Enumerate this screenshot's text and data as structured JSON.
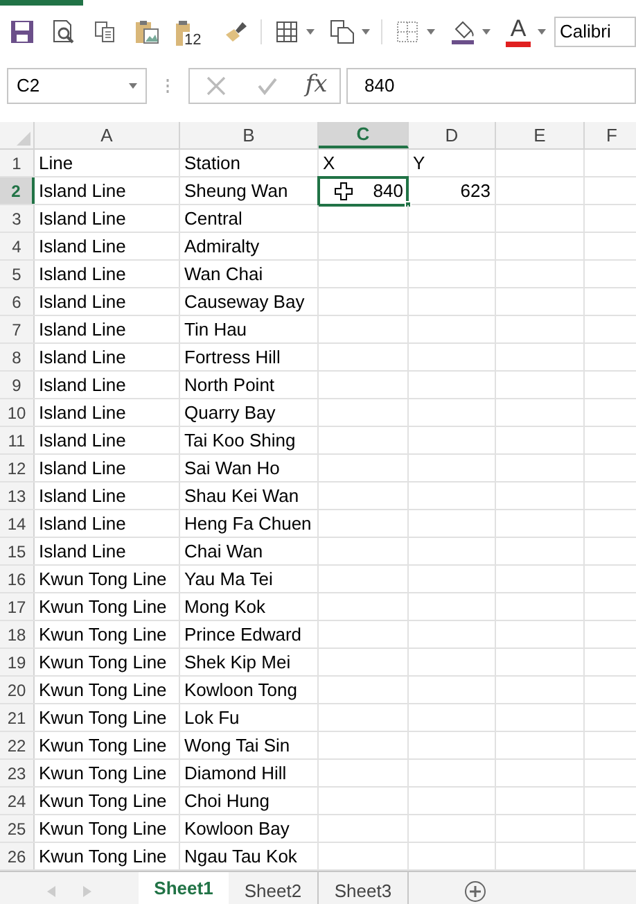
{
  "toolbar": [
    {
      "kind": "save",
      "dropdown": false
    },
    {
      "kind": "preview",
      "dropdown": false
    },
    {
      "kind": "copy",
      "dropdown": false
    },
    {
      "kind": "paste-picture",
      "dropdown": false
    },
    {
      "kind": "paste-values",
      "dropdown": false,
      "badge": "12"
    },
    {
      "kind": "painter",
      "dropdown": false
    },
    {
      "kind": "separator"
    },
    {
      "kind": "borders",
      "dropdown": true
    },
    {
      "kind": "paste-special",
      "dropdown": true
    },
    {
      "kind": "separator"
    },
    {
      "kind": "gridlines",
      "dropdown": true
    },
    {
      "kind": "fill-color",
      "dropdown": true
    },
    {
      "kind": "font-color",
      "dropdown": true,
      "text": "A"
    }
  ],
  "font_field": {
    "value": "Calibri"
  },
  "formula_bar": {
    "name_box": "C2",
    "fx": "fx",
    "value": "840",
    "cancel_disabled": true,
    "enter_disabled": true
  },
  "columns": [
    {
      "label": "A",
      "selected": false
    },
    {
      "label": "B",
      "selected": false
    },
    {
      "label": "C",
      "selected": true
    },
    {
      "label": "D",
      "selected": false
    },
    {
      "label": "E",
      "selected": false
    },
    {
      "label": "F",
      "selected": false
    }
  ],
  "rows": [
    {
      "number": "1",
      "selected": false,
      "cells": [
        "Line",
        "Station",
        "X",
        "Y"
      ]
    },
    {
      "number": "2",
      "selected": true,
      "cells": [
        "Island Line",
        "Sheung Wan"
      ],
      "numbers": [
        "840",
        "623"
      ]
    },
    {
      "number": "3",
      "selected": false,
      "cells": [
        "Island Line",
        "Central"
      ]
    },
    {
      "number": "4",
      "selected": false,
      "cells": [
        "Island Line",
        "Admiralty"
      ]
    },
    {
      "number": "5",
      "selected": false,
      "cells": [
        "Island Line",
        "Wan Chai"
      ]
    },
    {
      "number": "6",
      "selected": false,
      "cells": [
        "Island Line",
        "Causeway Bay"
      ]
    },
    {
      "number": "7",
      "selected": false,
      "cells": [
        "Island Line",
        "Tin Hau"
      ]
    },
    {
      "number": "8",
      "selected": false,
      "cells": [
        "Island Line",
        "Fortress Hill"
      ]
    },
    {
      "number": "9",
      "selected": false,
      "cells": [
        "Island Line",
        "North Point"
      ]
    },
    {
      "number": "10",
      "selected": false,
      "cells": [
        "Island Line",
        "Quarry Bay"
      ]
    },
    {
      "number": "11",
      "selected": false,
      "cells": [
        "Island Line",
        "Tai Koo Shing"
      ]
    },
    {
      "number": "12",
      "selected": false,
      "cells": [
        "Island Line",
        "Sai Wan Ho"
      ]
    },
    {
      "number": "13",
      "selected": false,
      "cells": [
        "Island Line",
        "Shau Kei Wan"
      ]
    },
    {
      "number": "14",
      "selected": false,
      "cells": [
        "Island Line",
        "Heng Fa Chuen"
      ]
    },
    {
      "number": "15",
      "selected": false,
      "cells": [
        "Island Line",
        "Chai Wan"
      ]
    },
    {
      "number": "16",
      "selected": false,
      "cells": [
        "Kwun Tong Line",
        "Yau Ma Tei"
      ]
    },
    {
      "number": "17",
      "selected": false,
      "cells": [
        "Kwun Tong Line",
        "Mong Kok"
      ]
    },
    {
      "number": "18",
      "selected": false,
      "cells": [
        "Kwun Tong Line",
        "Prince Edward"
      ]
    },
    {
      "number": "19",
      "selected": false,
      "cells": [
        "Kwun Tong Line",
        "Shek Kip Mei"
      ]
    },
    {
      "number": "20",
      "selected": false,
      "cells": [
        "Kwun Tong Line",
        "Kowloon Tong"
      ]
    },
    {
      "number": "21",
      "selected": false,
      "cells": [
        "Kwun Tong Line",
        "Lok Fu"
      ]
    },
    {
      "number": "22",
      "selected": false,
      "cells": [
        "Kwun Tong Line",
        "Wong Tai Sin"
      ]
    },
    {
      "number": "23",
      "selected": false,
      "cells": [
        "Kwun Tong Line",
        "Diamond Hill"
      ]
    },
    {
      "number": "24",
      "selected": false,
      "cells": [
        "Kwun Tong Line",
        "Choi Hung"
      ]
    },
    {
      "number": "25",
      "selected": false,
      "cells": [
        "Kwun Tong Line",
        "Kowloon Bay"
      ]
    },
    {
      "number": "26",
      "selected": false,
      "cells": [
        "Kwun Tong Line",
        "Ngau Tau Kok"
      ]
    }
  ],
  "sheet_tabs": [
    {
      "label": "Sheet1",
      "selected": true
    },
    {
      "label": "Sheet2",
      "selected": false
    },
    {
      "label": "Sheet3",
      "selected": false
    }
  ]
}
